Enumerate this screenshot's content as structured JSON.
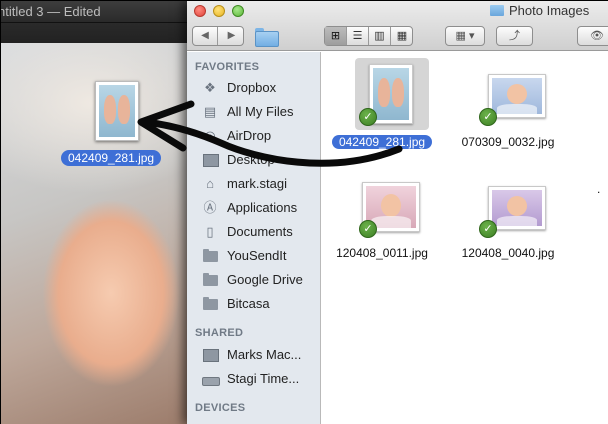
{
  "background_window": {
    "title": "ntitled 3 — Edited"
  },
  "drag_ghost": {
    "filename": "042409_281.jpg"
  },
  "finder": {
    "title": "Photo Images",
    "toolbar": {
      "back_icon": "chevron-left",
      "forward_icon": "chevron-right",
      "view_modes": [
        "icon-view",
        "list-view",
        "column-view",
        "coverflow-view"
      ],
      "active_view": "icon-view",
      "arrange_icon": "grid-arrange",
      "share_icon": "share-arrow",
      "quicklook_icon": "eye"
    },
    "sidebar": {
      "favorites_heading": "FAVORITES",
      "favorites": [
        {
          "label": "Dropbox",
          "icon": "dropbox-icon"
        },
        {
          "label": "All My Files",
          "icon": "all-files-icon"
        },
        {
          "label": "AirDrop",
          "icon": "airdrop-icon"
        },
        {
          "label": "Desktop",
          "icon": "desktop-icon"
        },
        {
          "label": "mark.stagi",
          "icon": "home-icon"
        },
        {
          "label": "Applications",
          "icon": "applications-icon"
        },
        {
          "label": "Documents",
          "icon": "documents-icon"
        },
        {
          "label": "YouSendIt",
          "icon": "folder-icon"
        },
        {
          "label": "Google Drive",
          "icon": "folder-icon"
        },
        {
          "label": "Bitcasa",
          "icon": "folder-icon"
        }
      ],
      "shared_heading": "SHARED",
      "shared": [
        {
          "label": "Marks Mac...",
          "icon": "computer-icon"
        },
        {
          "label": "Stagi Time...",
          "icon": "time-capsule-icon"
        }
      ],
      "devices_heading": "DEVICES"
    },
    "files": [
      {
        "name": "042409_281.jpg",
        "selected": true,
        "synced": true
      },
      {
        "name": "070309_0032.jpg",
        "selected": false,
        "synced": true
      },
      {
        "name": "120408_0011.jpg",
        "selected": false,
        "synced": true
      },
      {
        "name": "120408_0040.jpg",
        "selected": false,
        "synced": true
      }
    ],
    "cut_off_label": "."
  }
}
